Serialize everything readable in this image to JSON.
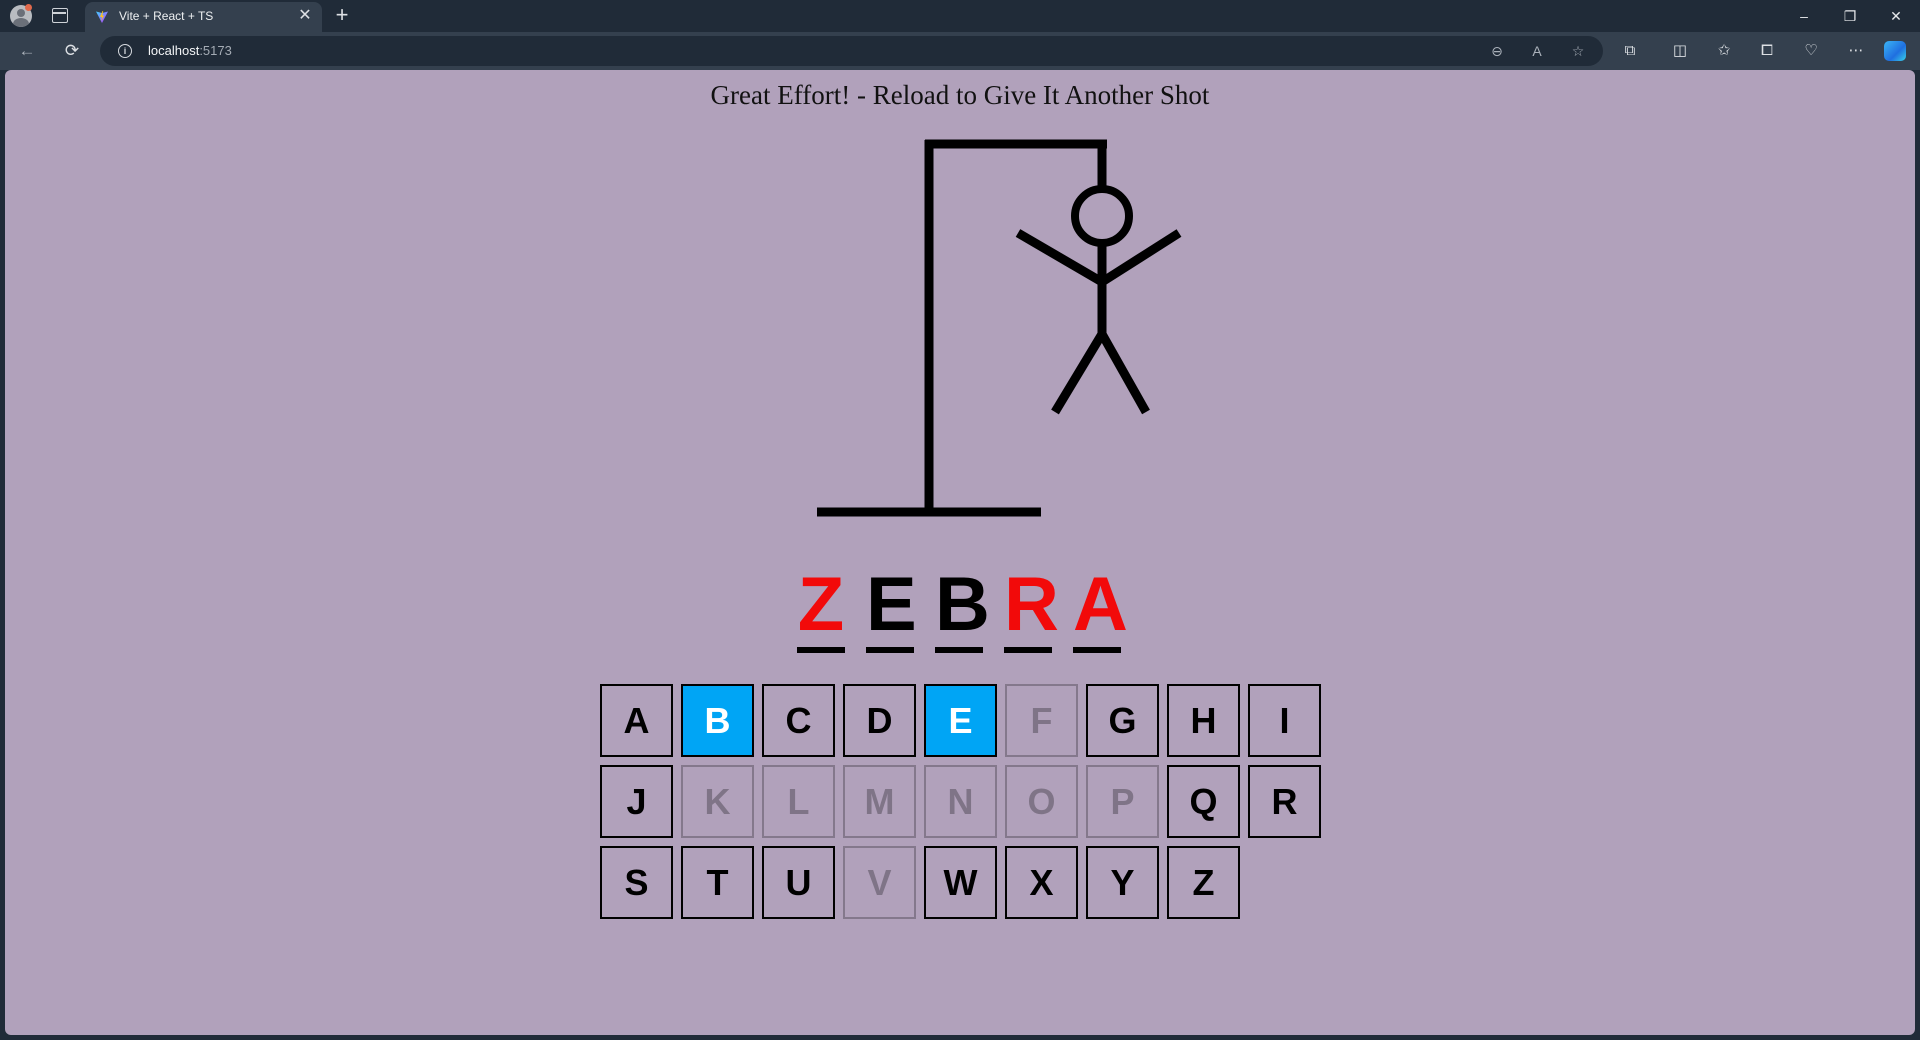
{
  "browser": {
    "tab_title": "Vite + React + TS",
    "url_host": "localhost",
    "url_port": ":5173",
    "tab_close_glyph": "✕",
    "new_tab_glyph": "+",
    "minimize_glyph": "–",
    "restore_glyph": "❐",
    "close_glyph": "✕"
  },
  "game": {
    "status_message": "Great Effort! - Reload to Give It Another Shot",
    "word": [
      {
        "letter": "Z",
        "state": "missed"
      },
      {
        "letter": "E",
        "state": "found"
      },
      {
        "letter": "B",
        "state": "found"
      },
      {
        "letter": "R",
        "state": "missed"
      },
      {
        "letter": "A",
        "state": "missed"
      }
    ],
    "keys": [
      {
        "letter": "A",
        "state": "available"
      },
      {
        "letter": "B",
        "state": "correct"
      },
      {
        "letter": "C",
        "state": "available"
      },
      {
        "letter": "D",
        "state": "available"
      },
      {
        "letter": "E",
        "state": "correct"
      },
      {
        "letter": "F",
        "state": "used"
      },
      {
        "letter": "G",
        "state": "available"
      },
      {
        "letter": "H",
        "state": "available"
      },
      {
        "letter": "I",
        "state": "available"
      },
      {
        "letter": "J",
        "state": "available"
      },
      {
        "letter": "K",
        "state": "used"
      },
      {
        "letter": "L",
        "state": "used"
      },
      {
        "letter": "M",
        "state": "used"
      },
      {
        "letter": "N",
        "state": "used"
      },
      {
        "letter": "O",
        "state": "used"
      },
      {
        "letter": "P",
        "state": "used"
      },
      {
        "letter": "Q",
        "state": "available"
      },
      {
        "letter": "R",
        "state": "available"
      },
      {
        "letter": "S",
        "state": "available"
      },
      {
        "letter": "T",
        "state": "available"
      },
      {
        "letter": "U",
        "state": "available"
      },
      {
        "letter": "V",
        "state": "used"
      },
      {
        "letter": "W",
        "state": "available"
      },
      {
        "letter": "X",
        "state": "available"
      },
      {
        "letter": "Y",
        "state": "available"
      },
      {
        "letter": "Z",
        "state": "available"
      }
    ],
    "colors": {
      "background": "#b1a1bb",
      "correct_key": "#00a5f5",
      "missed_letter": "#f20a0a"
    }
  }
}
